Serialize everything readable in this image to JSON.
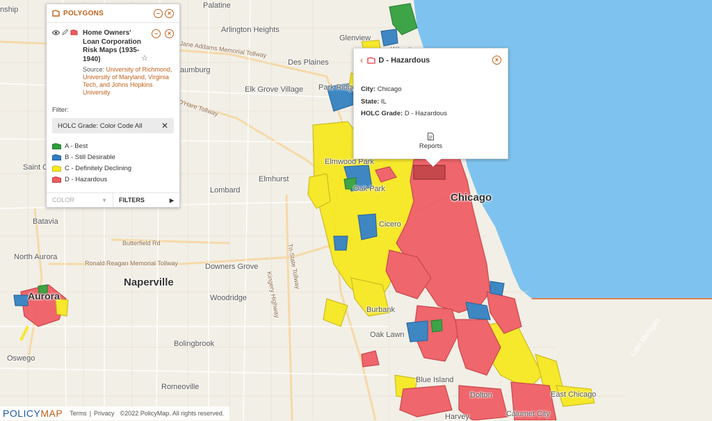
{
  "panel": {
    "title": "POLYGONS",
    "layer_title": "Home Owners' Loan Corporation Risk Maps (1935-1940)",
    "source_label": "Source: ",
    "source_link": "University of Richmond, University of Maryland, Virginia Tech, and Johns Hopkins University",
    "filter_label": "Filter:",
    "filter_chip": "HOLC Grade: Color Code All",
    "legend": [
      {
        "label": "A - Best",
        "color": "#2e9e3a"
      },
      {
        "label": "B - Still Desirable",
        "color": "#2f7fc1"
      },
      {
        "label": "C - Definitely Declining",
        "color": "#f7e81c"
      },
      {
        "label": "D - Hazardous",
        "color": "#ef5b62"
      }
    ],
    "footer_color": "COLOR",
    "footer_filters": "FILTERS"
  },
  "popup": {
    "title": "D - Hazardous",
    "city_label": "City:",
    "city": "Chicago",
    "state_label": "State:",
    "state": "IL",
    "grade_label": "HOLC Grade:",
    "grade": "D - Hazardous",
    "reports": "Reports"
  },
  "map_labels": {
    "palatine": "Palatine",
    "arlington": "Arlington Heights",
    "glenview": "Glenview",
    "wilmette": "Wilmette",
    "desplaines": "Des Plaines",
    "schaumburg": "Schaumburg",
    "elkgrove": "Elk Grove Village",
    "parkridge": "Park Ridge",
    "elmwood": "Elmwood Park",
    "oakpark": "Oak Park",
    "elmhurst": "Elmhurst",
    "lombard": "Lombard",
    "chicago": "Chicago",
    "cicero": "Cicero",
    "stcharles": "Saint C",
    "batavia": "Batavia",
    "northaurora": "North Aurora",
    "aurora": "Aurora",
    "naperville": "Naperville",
    "downersgrove": "Downers Grove",
    "woodridge": "Woodridge",
    "burbank": "Burbank",
    "oaklawn": "Oak Lawn",
    "bolingbrook": "Bolingbrook",
    "oswego": "Oswego",
    "romeoville": "Romeoville",
    "blueisland": "Blue Island",
    "dolton": "Dolton",
    "eastchicago": "East Chicago",
    "calumet": "Calumet City",
    "harvey": "Harvey",
    "township": "nship",
    "lakemichigan": "Lake Michigan",
    "tollway1": "Jane Addams Memorial Tollway",
    "tollway2": "Ronald Reagan Memorial Tollway",
    "ohare": "O'Hare Tollway",
    "butterfield": "Butterfield Rd",
    "kingery": "Kingery Highway",
    "tristate": "Tri-State Tollway"
  },
  "attribution": {
    "logo_policy": "POLICY",
    "logo_map": "MAP",
    "terms": "Terms",
    "privacy": "Privacy",
    "separator": "|",
    "copyright": "©2022 PolicyMap. All rights reserved."
  },
  "colors": {
    "A": "#2e9e3a",
    "B": "#2f7fc1",
    "C": "#f7e81c",
    "D": "#ef5b62",
    "lake": "#7ec3ef",
    "accent": "#c0601a"
  }
}
